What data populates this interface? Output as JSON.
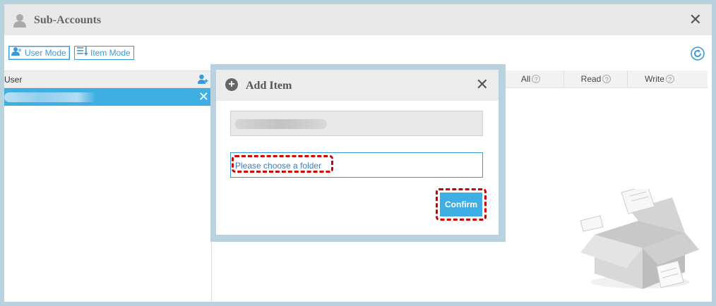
{
  "window": {
    "title": "Sub-Accounts"
  },
  "toolbar": {
    "user_mode_label": "User Mode",
    "item_mode_label": "Item Mode"
  },
  "users_panel": {
    "header_label": "User"
  },
  "columns": {
    "all": "All",
    "read": "Read",
    "write": "Write"
  },
  "dialog": {
    "title": "Add Item",
    "folder_placeholder": "Please choose a folder",
    "confirm_label": "Confirm"
  },
  "colors": {
    "accent": "#3faee2",
    "frame": "#b9d2df",
    "highlight": "#cc0000"
  },
  "icons": {
    "title": "user-icon",
    "close": "close-icon",
    "refresh": "refresh-icon",
    "add_user": "add-user-icon",
    "help": "question-icon",
    "add": "plus-icon"
  }
}
